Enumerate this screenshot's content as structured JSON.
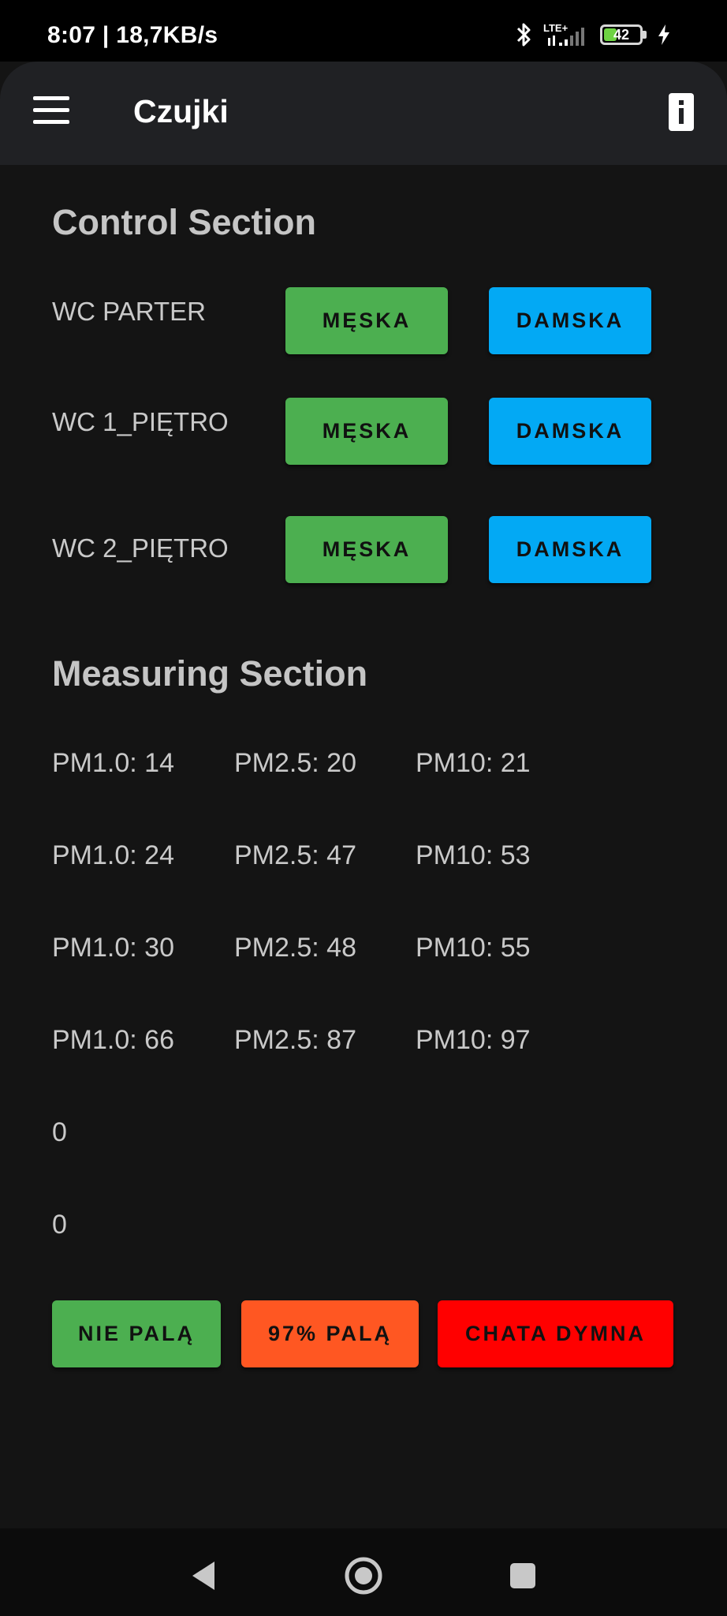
{
  "status_bar": {
    "time_speed": "8:07 | 18,7KB/s",
    "network_label": "LTE+",
    "battery_level": 42,
    "battery_text": "42",
    "icons": [
      "bluetooth-icon",
      "signal-icon",
      "battery-icon",
      "charging-bolt-icon"
    ]
  },
  "app_bar": {
    "title": "Czujki",
    "menu_icon": "hamburger-menu-icon",
    "action_icon": "info-icon"
  },
  "control_section": {
    "title": "Control Section",
    "rows": [
      {
        "label": "WC PARTER",
        "button_men": "MĘSKA",
        "button_women": "DAMSKA"
      },
      {
        "label": "WC 1_PIĘTRO",
        "button_men": "MĘSKA",
        "button_women": "DAMSKA"
      },
      {
        "label": "WC 2_PIĘTRO",
        "button_men": "MĘSKA",
        "button_women": "DAMSKA"
      }
    ]
  },
  "measuring_section": {
    "title": "Measuring Section",
    "rows": [
      {
        "pm1": "PM1.0: 14",
        "pm25": "PM2.5: 20",
        "pm10": "PM10: 21"
      },
      {
        "pm1": "PM1.0: 24",
        "pm25": "PM2.5: 47",
        "pm10": "PM10: 53"
      },
      {
        "pm1": "PM1.0: 30",
        "pm25": "PM2.5: 48",
        "pm10": "PM10: 55"
      },
      {
        "pm1": "PM1.0: 66",
        "pm25": "PM2.5: 87",
        "pm10": "PM10: 97"
      }
    ],
    "values": [
      "0",
      "0"
    ]
  },
  "status_buttons": {
    "not_smoking": "NIE PALĄ",
    "smoking": "97% PALĄ",
    "smoke_house": "CHATA DYMNA"
  },
  "colors": {
    "background": "#141414",
    "app_bar": "#202124",
    "green": "#4caf50",
    "blue": "#03a9f4",
    "orange": "#ff5722",
    "red": "#ff0000"
  },
  "nav_bar": {
    "icons": [
      "back-icon",
      "home-icon",
      "recents-icon"
    ]
  }
}
